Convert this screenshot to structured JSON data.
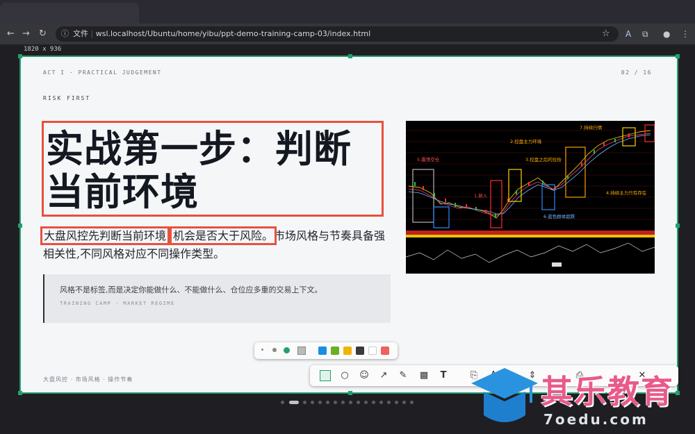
{
  "browser": {
    "tab_title": "",
    "security_label": "文件",
    "url": "wsl.localhost/Ubuntu/home/yibu/ppt-demo-training-camp-03/index.html"
  },
  "viewport_label": "1820 x 936",
  "slide": {
    "kicker": "ACT I · PRACTICAL JUDGEMENT",
    "pager": "02 / 16",
    "section": "RISK FIRST",
    "headline_line1": "实战第一步：判断",
    "headline_line2": "当前环境",
    "lead_hl1": "大盘风控先判断当前环境",
    "lead_hl2": "机会是否大于风险。",
    "lead_rest": "市场风格与节奏具备强相关性,不同风格对应不同操作类型。",
    "quote_text": "风格不是标签,而是决定你能做什么、不能做什么、仓位应多重的交易上下文。",
    "quote_cite": "TRAINING CAMP · MARKET REGIME",
    "footer_tags": "大盘风控 · 市场风格 · 操作节奏"
  },
  "chart_image": {
    "annotations": [
      "5.震荡空仓",
      "2.控盘主力环境",
      "3.控盘之后的拉抬",
      "7.持续行情",
      "1.新入",
      "6.蓝色群体超跌",
      "4.持续主力只有存在"
    ]
  },
  "toolbar": {
    "colors": [
      "#1a8fe0",
      "#6ab023",
      "#f0b400",
      "#3a3a3a",
      "#ffffff",
      "#f0625a"
    ],
    "tools": [
      "rectangle-tool",
      "ellipse-tool",
      "emoji-tool",
      "arrow-tool",
      "pen-tool",
      "mosaic-tool",
      "text-tool"
    ]
  },
  "watermark": {
    "brand": "其乐教育",
    "url": "7oedu.com"
  }
}
